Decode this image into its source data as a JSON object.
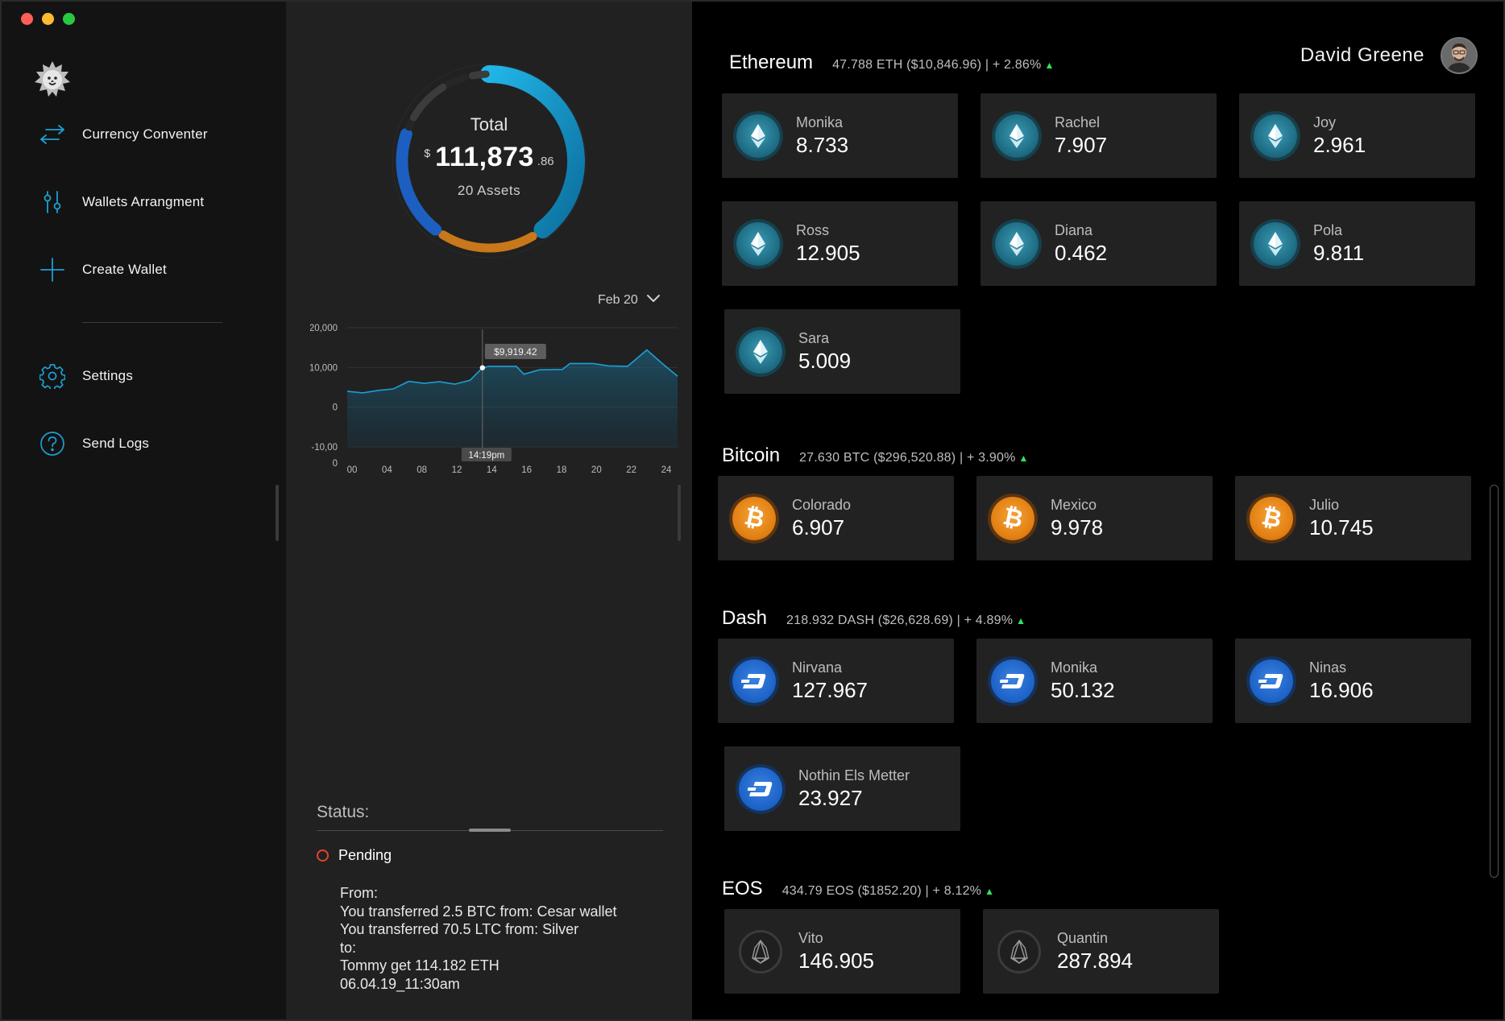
{
  "sidebar": {
    "items": [
      {
        "label": "Currency Conventer",
        "icon": "arrows-exchange-icon"
      },
      {
        "label": "Wallets  Arrangment",
        "icon": "sliders-icon"
      },
      {
        "label": "Create Wallet",
        "icon": "plus-icon"
      },
      {
        "label": "Settings",
        "icon": "gear-icon"
      },
      {
        "label": "Send Logs",
        "icon": "question-icon"
      }
    ]
  },
  "summary": {
    "title": "Total",
    "currency": "$",
    "amount": "111,873",
    "cents": ".86",
    "assets": "20 Assets"
  },
  "chart_data": {
    "type": "area",
    "x": [
      "00",
      "04",
      "08",
      "12",
      "14",
      "16",
      "18",
      "20",
      "22",
      "24"
    ],
    "y_ticks": [
      "20,000",
      "10,000",
      "0",
      "-10,00",
      "0"
    ],
    "ylim": [
      -10000,
      20000
    ],
    "series": [
      {
        "values": [
          [
            0,
            4000
          ],
          [
            2,
            3600
          ],
          [
            4,
            4200
          ],
          [
            6,
            4600
          ],
          [
            8,
            6500
          ],
          [
            10,
            6000
          ],
          [
            12,
            6400
          ],
          [
            14,
            5800
          ],
          [
            16,
            6800
          ],
          [
            17.6,
            9919
          ],
          [
            18.5,
            10300
          ],
          [
            22,
            10300
          ],
          [
            23,
            8300
          ],
          [
            25,
            9400
          ],
          [
            28,
            9500
          ],
          [
            29,
            11000
          ],
          [
            32,
            11000
          ],
          [
            34,
            10400
          ],
          [
            36.5,
            10300
          ],
          [
            39,
            14400
          ],
          [
            41,
            11000
          ],
          [
            43,
            7800
          ]
        ]
      }
    ],
    "tooltip_value": "$9,919.42",
    "tooltip_time": "14:19pm",
    "accent": "#1b9fd4"
  },
  "date_filter": {
    "label": "Feb 20"
  },
  "status": {
    "title": "Status:",
    "state": "Pending",
    "lines": [
      "From:",
      "You transferred 2.5 BTC from: Cesar wallet",
      "You transferred 70.5 LTC from: Silver",
      "to:",
      "Tommy get 114.182 ETH",
      "06.04.19_11:30am"
    ]
  },
  "user": {
    "name": "David Greene"
  },
  "sections": [
    {
      "title": "Ethereum",
      "summary": "47.788 ETH ($10,846.96) | + 2.86%",
      "coin": "eth",
      "wallets": [
        {
          "name": "Monika",
          "value": "8.733"
        },
        {
          "name": "Rachel",
          "value": "7.907"
        },
        {
          "name": "Joy",
          "value": "2.961"
        },
        {
          "name": "Ross",
          "value": "12.905"
        },
        {
          "name": "Diana",
          "value": "0.462"
        },
        {
          "name": "Pola",
          "value": "9.811"
        },
        {
          "name": "Sara",
          "value": "5.009"
        }
      ]
    },
    {
      "title": "Bitcoin",
      "summary": "27.630 BTC ($296,520.88) | + 3.90%",
      "coin": "btc",
      "wallets": [
        {
          "name": "Colorado",
          "value": "6.907"
        },
        {
          "name": "Mexico",
          "value": "9.978"
        },
        {
          "name": "Julio",
          "value": "10.745"
        }
      ]
    },
    {
      "title": "Dash",
      "summary": "218.932 DASH ($26,628.69) | + 4.89%",
      "coin": "dash",
      "wallets": [
        {
          "name": "Nirvana",
          "value": "127.967"
        },
        {
          "name": "Monika",
          "value": "50.132"
        },
        {
          "name": "Ninas",
          "value": "16.906"
        },
        {
          "name": "Nothin Els Metter",
          "value": "23.927"
        }
      ]
    },
    {
      "title": "EOS",
      "summary": "434.79 EOS ($1852.20) | + 8.12%",
      "coin": "eos",
      "wallets": [
        {
          "name": "Vito",
          "value": "146.905"
        },
        {
          "name": "Quantin",
          "value": "287.894"
        }
      ]
    }
  ],
  "colors": {
    "accent": "#1b9fd4",
    "ring_blue": "#1c5fc0",
    "ring_orange": "#c8771a",
    "ring_gray": "#3c3c3c",
    "up": "#2ee65a",
    "pending": "#e2452b"
  }
}
